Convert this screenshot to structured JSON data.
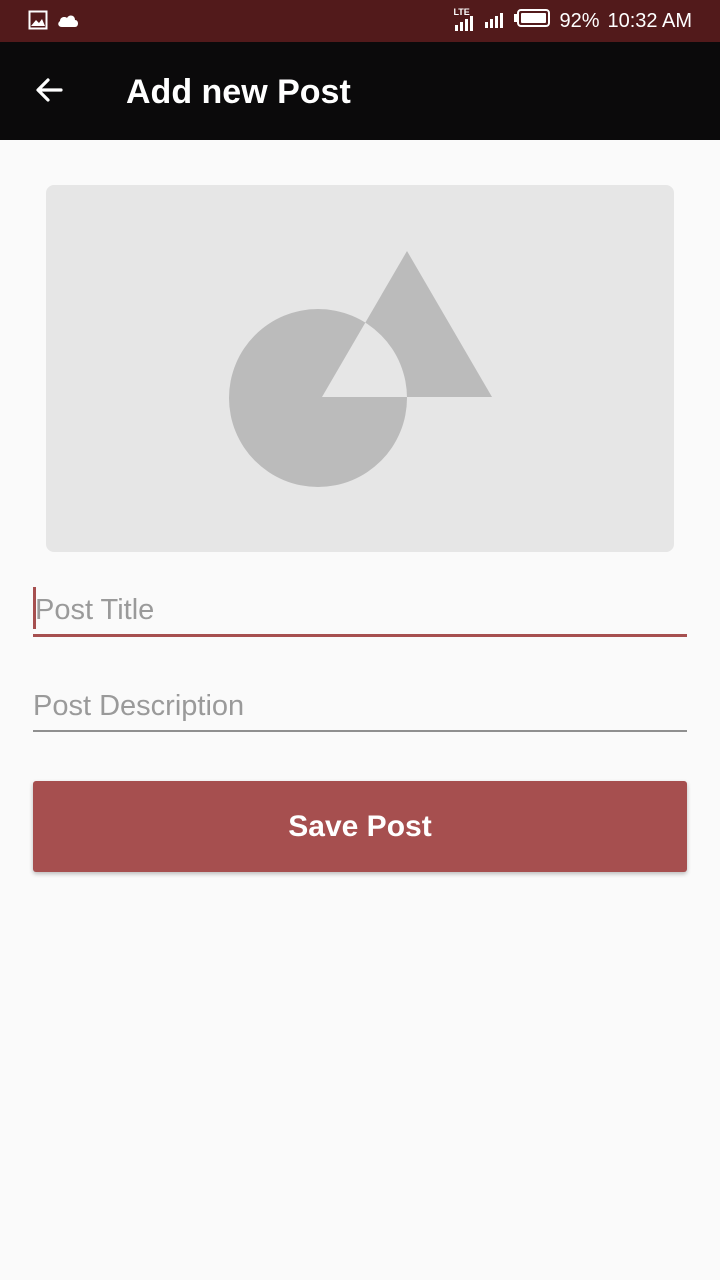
{
  "status_bar": {
    "network": "LTE",
    "battery": "92%",
    "time": "10:32 AM",
    "icons": [
      "image-icon",
      "cloud-icon",
      "signal-icon",
      "battery-icon"
    ]
  },
  "app_bar": {
    "title": "Add new Post",
    "back_icon": "arrow-left-icon"
  },
  "image_placeholder": {
    "icon": "shapes-icon"
  },
  "form": {
    "title_placeholder": "Post Title",
    "description_placeholder": "Post Description",
    "title_value": "",
    "description_value": ""
  },
  "actions": {
    "save_label": "Save Post"
  },
  "colors": {
    "status_bar": "#521a1b",
    "app_bar": "#0b0a0b",
    "accent": "#a64f4f",
    "background": "#fafafa",
    "placeholder_bg": "#e6e6e6",
    "placeholder_shape": "#bbbbbb"
  }
}
